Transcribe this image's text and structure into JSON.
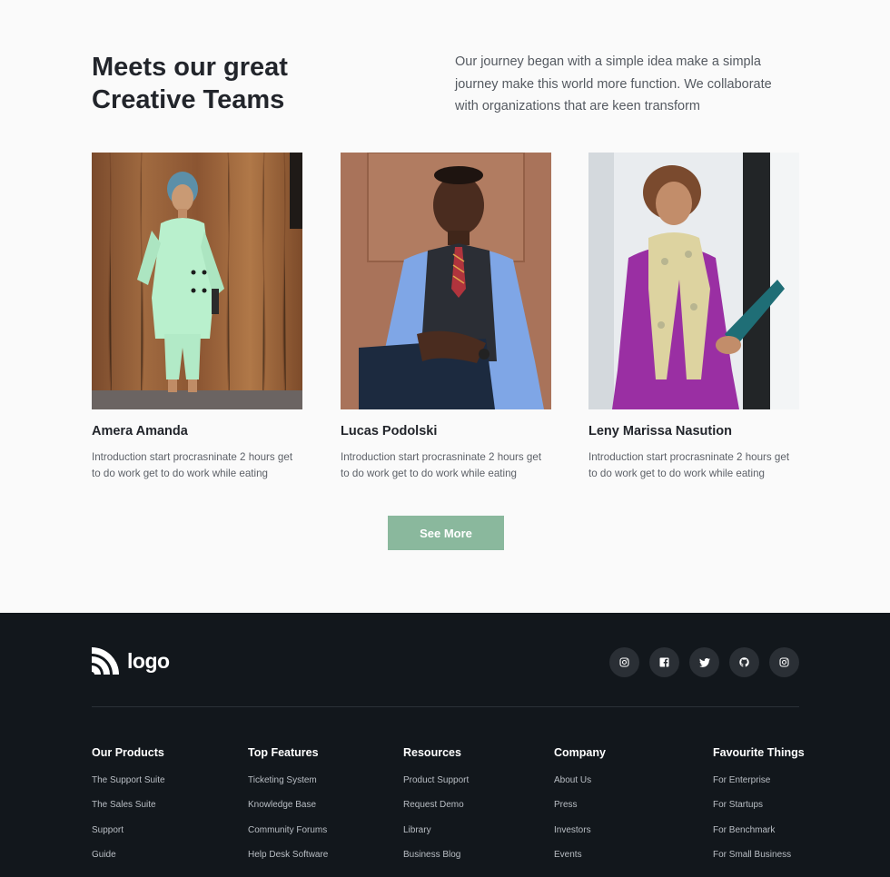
{
  "team": {
    "title": "Meets our great Creative Teams",
    "intro": "Our journey began with a simple idea make a simpla journey make this world more function. We collaborate with organizations that are keen transform",
    "members": [
      {
        "name": "Amera Amanda",
        "bio": "Introduction start procrasninate 2 hours get to do work get to do work while eating"
      },
      {
        "name": "Lucas Podolski",
        "bio": "Introduction start procrasninate 2 hours get to do work get to do work while eating"
      },
      {
        "name": "Leny Marissa Nasution",
        "bio": "Introduction start procrasninate 2 hours get to do work get to do work while eating"
      }
    ],
    "see_more_label": "See More"
  },
  "footer": {
    "logo_text": "logo",
    "socials": [
      "instagram-icon",
      "facebook-icon",
      "twitter-icon",
      "github-icon",
      "dribbble-icon"
    ],
    "columns": [
      {
        "heading": "Our Products",
        "links": [
          "The Support Suite",
          "The Sales Suite",
          "Support",
          "Guide"
        ]
      },
      {
        "heading": "Top Features",
        "links": [
          "Ticketing System",
          "Knowledge Base",
          "Community Forums",
          "Help Desk Software"
        ]
      },
      {
        "heading": "Resources",
        "links": [
          "Product Support",
          "Request Demo",
          "Library",
          "Business Blog"
        ]
      },
      {
        "heading": "Company",
        "links": [
          "About Us",
          "Press",
          "Investors",
          "Events"
        ]
      },
      {
        "heading": "Favourite Things",
        "links": [
          "For Enterprise",
          "For Startups",
          "For Benchmark",
          "For Small Business"
        ]
      }
    ]
  },
  "colors": {
    "accent": "#8ab89d",
    "footer_bg": "#12171c",
    "page_bg": "#fafafa"
  }
}
